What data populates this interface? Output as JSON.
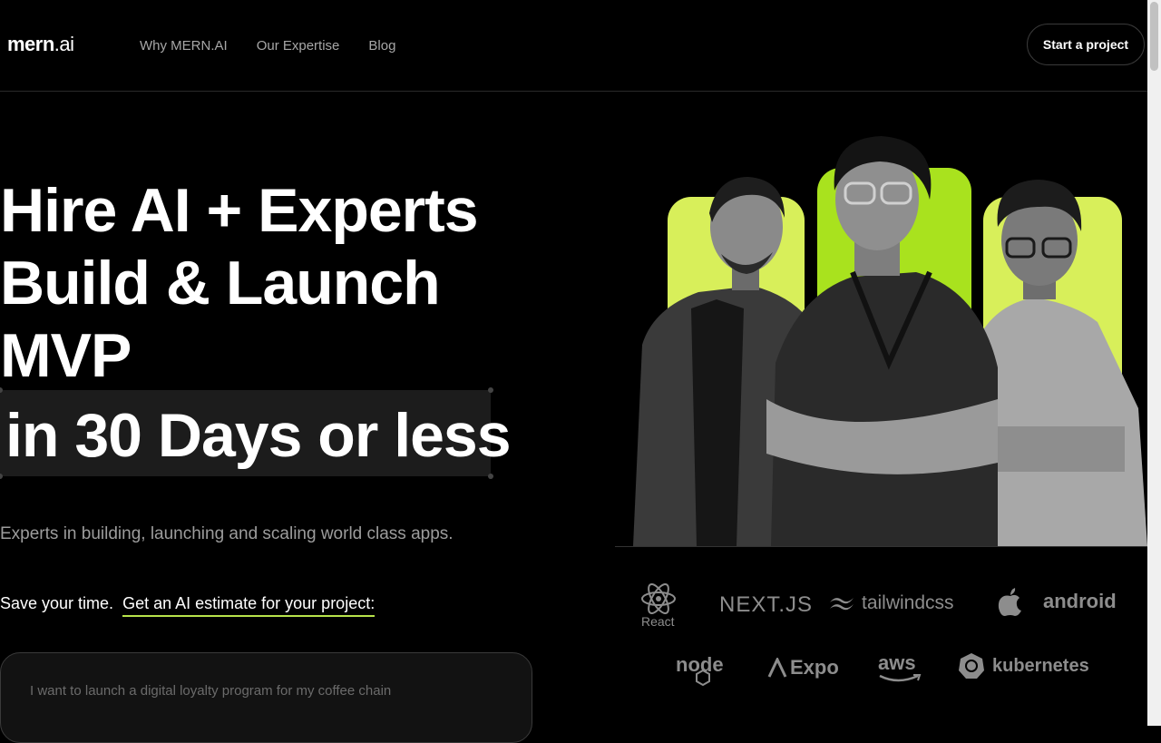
{
  "header": {
    "logo_main": "mern",
    "logo_suffix": ".ai",
    "nav": [
      "Why MERN.AI",
      "Our Expertise",
      "Blog"
    ],
    "cta_label": "Start a project"
  },
  "hero": {
    "headline_lines": [
      "Hire AI + Experts",
      "Build & Launch",
      "MVP"
    ],
    "highlight_line": "in 30 Days or less",
    "subtitle": "Experts in building, launching and scaling world class apps.",
    "save_text": "Save your time.",
    "estimate_link": "Get an AI estimate for your project:",
    "prompt_placeholder": "I want to launch a digital loyalty program for my coffee chain"
  },
  "tech_logos": {
    "row1": [
      "React",
      "NEXT.JS",
      "tailwindcss",
      "apple",
      "android"
    ],
    "row2": [
      "node",
      "Expo",
      "aws",
      "kubernetes"
    ]
  },
  "colors": {
    "accent": "#b7e34b",
    "pillar_light": "#d8ef5a",
    "pillar_bright": "#a9e21e",
    "background": "#000000"
  }
}
